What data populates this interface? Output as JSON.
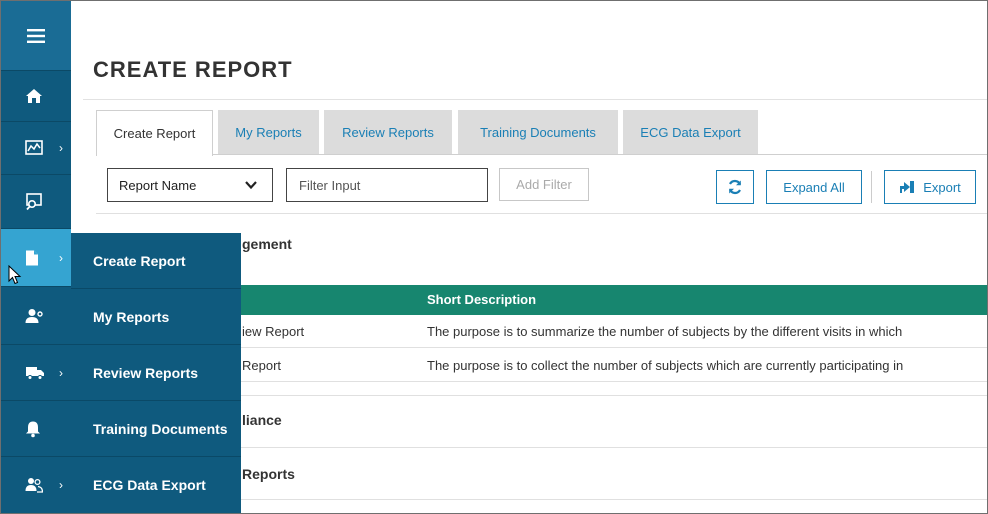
{
  "page": {
    "title": "CREATE REPORT"
  },
  "rail": {
    "items": [
      {
        "name": "menu-icon"
      },
      {
        "name": "home-icon"
      },
      {
        "name": "chart-icon",
        "has_chevron": true
      },
      {
        "name": "search-doc-icon"
      },
      {
        "name": "document-icon",
        "has_chevron": true,
        "active": true
      },
      {
        "name": "user-settings-icon"
      },
      {
        "name": "truck-icon",
        "has_chevron": true
      },
      {
        "name": "bell-icon"
      },
      {
        "name": "user-group-icon",
        "has_chevron": true
      }
    ],
    "chevron": "›"
  },
  "flyout": {
    "items": [
      "Create Report",
      "My Reports",
      "Review Reports",
      "Training Documents",
      "ECG Data Export"
    ]
  },
  "tabs": [
    "Create Report",
    "My Reports",
    "Review Reports",
    "Training Documents",
    "ECG Data Export"
  ],
  "toolbar": {
    "select_value": "Report Name",
    "filter_placeholder": "Filter Input",
    "add_filter_label": "Add Filter",
    "expand_all_label": "Expand All",
    "export_label": "Export"
  },
  "sections": {
    "first": "gement",
    "second": "liance",
    "third": "Reports"
  },
  "grid": {
    "header": "Short Description",
    "rows": [
      {
        "name": "iew Report",
        "description": "The purpose is to summarize the number of subjects by the different visits in which"
      },
      {
        "name": "Report",
        "description": "The purpose is to collect the number of subjects which are currently participating in"
      }
    ]
  },
  "colors": {
    "rail": "#0f5a7e",
    "rail_active": "#35a4d1",
    "accent": "#1a7fb5",
    "grid_header": "#17866f"
  }
}
